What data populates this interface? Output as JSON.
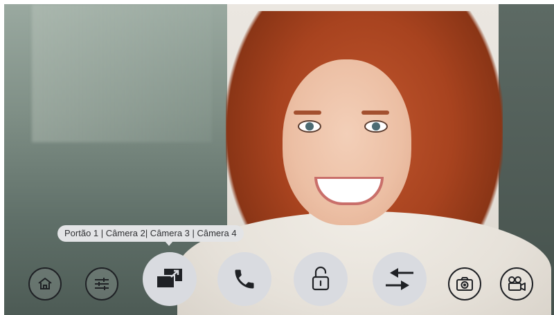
{
  "video": {
    "source_label": "Portão 1 | Câmera 2| Câmera 3 | Câmera 4"
  },
  "controls": {
    "small": [
      "home-icon",
      "settings-sliders-icon",
      "snapshot-camera-icon",
      "record-video-icon"
    ],
    "large": [
      "switch-camera-icon",
      "call-phone-icon",
      "unlock-icon",
      "intercom-transfer-icon"
    ]
  },
  "colors": {
    "button_fill": "#d9dbe0",
    "icon_dark": "#1f2125",
    "tooltip_bg": "#e3e4e6"
  }
}
